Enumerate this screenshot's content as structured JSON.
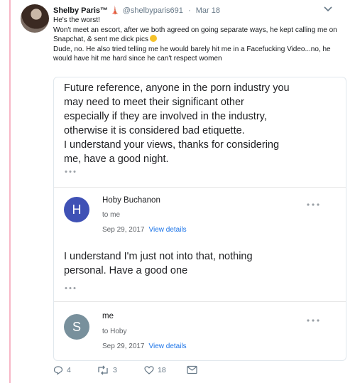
{
  "tweet": {
    "author_name": "Shelby Paris™",
    "handle": "@shelbyparis691",
    "dot": "·",
    "date": "Mar 18",
    "lines": [
      "He's the worst!",
      "Won't meet an escort, after we both agreed on going separate ways, he kept calling me on Snapchat, & sent me dick pics",
      "Dude, no. He also tried telling me he would barely hit me in a Facefucking Video...no, he would have hit me hard since he can't respect women"
    ],
    "author_icon": "eiffel-tower-icon",
    "emoji": "expressionless-face-emoji"
  },
  "email": {
    "quoted_text": "Future reference, anyone in the porn industry you\nmay need to meet their significant other\nespecially if they are involved in the industry,\notherwise it is considered bad etiquette.\nI understand your views, thanks for considering\nme, have a good night.",
    "messages": [
      {
        "initial": "H",
        "sender": "Hoby Buchanon",
        "recipient": "to me",
        "date": "Sep 29, 2017",
        "details_link": "View details",
        "avatar_color": "#3f51b5",
        "body": "I understand I'm just not into that, nothing\npersonal.  Have a good one"
      },
      {
        "initial": "S",
        "sender": "me",
        "recipient": "to Hoby",
        "date": "Sep 29, 2017",
        "details_link": "View details",
        "avatar_color": "#78909c"
      }
    ]
  },
  "actions": {
    "reply_count": "4",
    "retweet_count": "3",
    "like_count": "18"
  }
}
